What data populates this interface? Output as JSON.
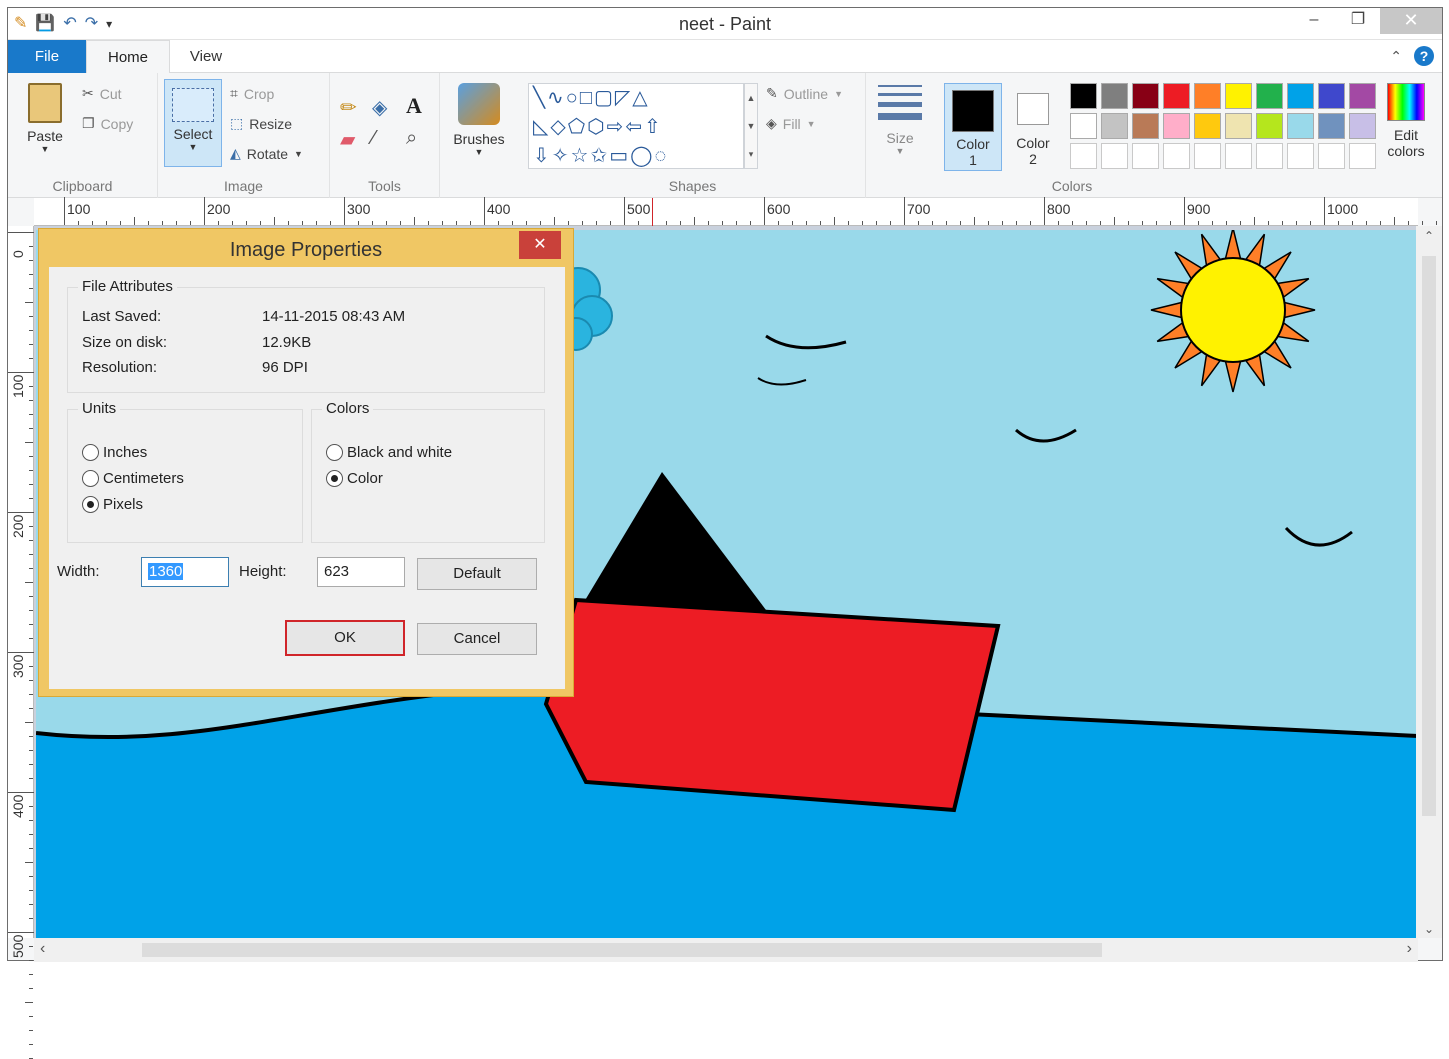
{
  "window": {
    "title": "neet - Paint",
    "minimize": "–",
    "maximize": "❐",
    "close": "✕"
  },
  "tabs": {
    "file": "File",
    "home": "Home",
    "view": "View"
  },
  "ribbon": {
    "clipboard": {
      "label": "Clipboard",
      "paste": "Paste",
      "cut": "Cut",
      "copy": "Copy"
    },
    "image": {
      "label": "Image",
      "select": "Select",
      "crop": "Crop",
      "resize": "Resize",
      "rotate": "Rotate"
    },
    "tools": {
      "label": "Tools"
    },
    "brushes": {
      "label": "Brushes"
    },
    "shapes": {
      "label": "Shapes",
      "outline": "Outline",
      "fill": "Fill"
    },
    "size": {
      "label": "Size"
    },
    "colors": {
      "label": "Colors",
      "color1_label": "Color",
      "color1_num": "1",
      "color2_label": "Color",
      "color2_num": "2",
      "edit_label": "Edit",
      "edit_label2": "colors",
      "color1": "#000000",
      "color2": "#ffffff",
      "palette_row1": [
        "#000000",
        "#7f7f7f",
        "#880015",
        "#ed1c24",
        "#ff7f27",
        "#fff200",
        "#22b14c",
        "#00a2e8",
        "#3f48cc",
        "#a349a4"
      ],
      "palette_row2": [
        "#ffffff",
        "#c3c3c3",
        "#b97a57",
        "#ffaec9",
        "#ffc90e",
        "#efe4b0",
        "#b5e61d",
        "#99d9ea",
        "#7092be",
        "#c8bfe7"
      ]
    }
  },
  "ruler": {
    "h_labels": [
      "100",
      "200",
      "300",
      "400",
      "500",
      "600",
      "700",
      "800",
      "900",
      "1000"
    ],
    "v_labels": [
      "0",
      "100",
      "200",
      "300",
      "400",
      "500"
    ]
  },
  "dialog": {
    "title": "Image Properties",
    "close": "✕",
    "file_attributes": {
      "legend": "File Attributes",
      "last_saved_label": "Last Saved:",
      "last_saved": "14-11-2015 08:43 AM",
      "size_label": "Size on disk:",
      "size": "12.9KB",
      "resolution_label": "Resolution:",
      "resolution": "96 DPI"
    },
    "units": {
      "legend": "Units",
      "inches": "Inches",
      "centimeters": "Centimeters",
      "pixels": "Pixels",
      "selected": "pixels"
    },
    "colors": {
      "legend": "Colors",
      "bw": "Black and white",
      "color": "Color",
      "selected": "color"
    },
    "width_label": "Width:",
    "width": "1360",
    "height_label": "Height:",
    "height": "623",
    "default": "Default",
    "ok": "OK",
    "cancel": "Cancel"
  }
}
